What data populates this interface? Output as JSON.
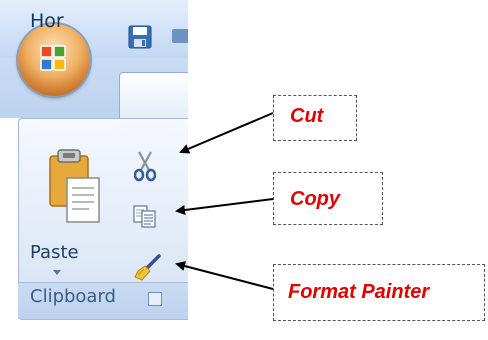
{
  "ribbon": {
    "tab": {
      "label": "Hor"
    },
    "group": {
      "label": "Clipboard",
      "paste_label": "Paste"
    },
    "icons": {
      "office_button": "office-logo-icon",
      "save": "save-icon",
      "paste": "clipboard-paste-icon",
      "cut": "scissors-icon",
      "copy": "copy-icon",
      "format_painter": "paintbrush-icon",
      "dialog_launcher": "dialog-launcher-icon"
    }
  },
  "annotations": {
    "cut": "Cut",
    "copy": "Copy",
    "format_painter": "Format Painter"
  },
  "colors": {
    "callout_text": "#e00000",
    "callout_border": "#555555",
    "arrow": "#000000"
  }
}
